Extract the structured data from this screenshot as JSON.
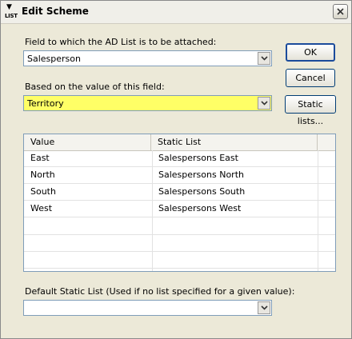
{
  "window": {
    "title": "Edit Scheme",
    "icon_label": "LIST",
    "icon_arrow": "▼"
  },
  "field1": {
    "label": "Field to which the AD List is to be attached:",
    "value": "Salesperson"
  },
  "field2": {
    "label": "Based on the value of this field:",
    "value": "Territory",
    "highlight_color": "#ffff66"
  },
  "buttons": {
    "ok": "OK",
    "cancel": "Cancel",
    "static_lists": "Static lists..."
  },
  "table": {
    "columns": [
      "Value",
      "Static List"
    ],
    "rows": [
      {
        "value": "East",
        "static_list": "Salespersons East"
      },
      {
        "value": "North",
        "static_list": "Salespersons North"
      },
      {
        "value": "South",
        "static_list": "Salespersons South"
      },
      {
        "value": "West",
        "static_list": "Salespersons West"
      }
    ]
  },
  "default_list": {
    "label": "Default Static List (Used if no list specified for a given value):",
    "value": ""
  }
}
